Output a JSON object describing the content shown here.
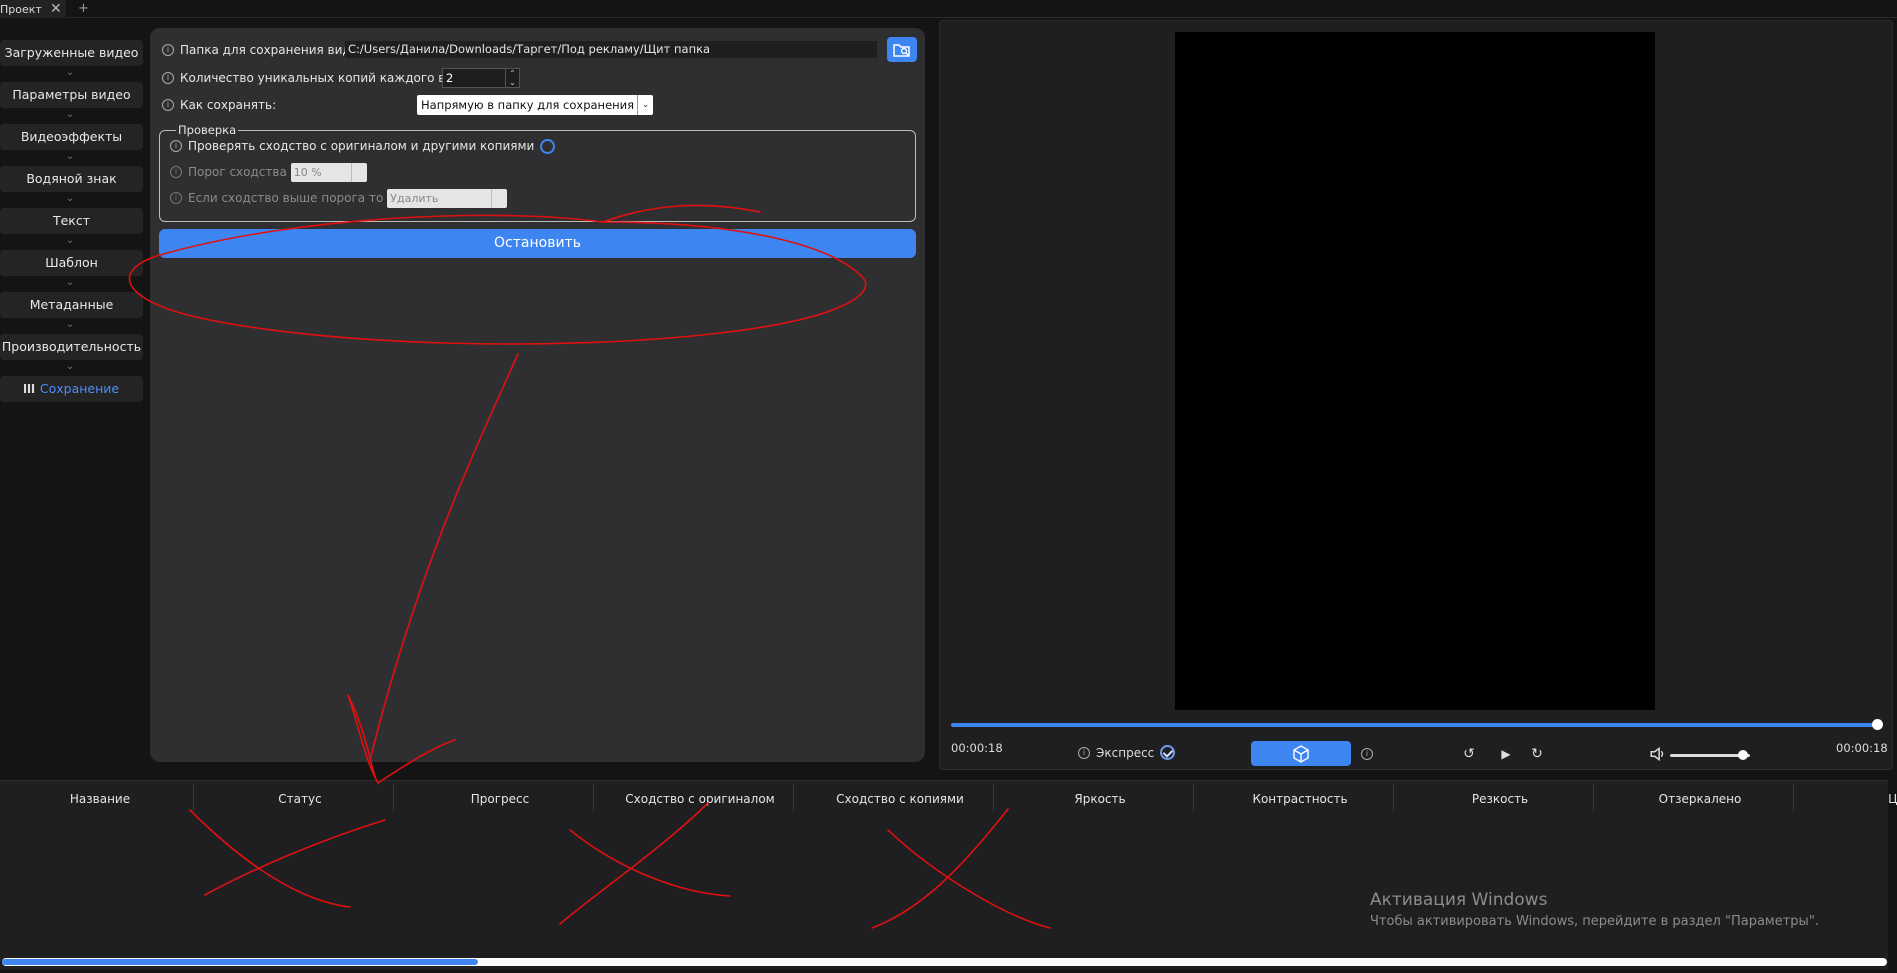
{
  "tabs": {
    "project_label": "Проект",
    "close_glyph": "✕",
    "add_glyph": "+"
  },
  "sidebar": {
    "items": [
      {
        "label": "Загруженные видео"
      },
      {
        "label": "Параметры видео"
      },
      {
        "label": "Видеоэффекты"
      },
      {
        "label": "Водяной знак"
      },
      {
        "label": "Текст"
      },
      {
        "label": "Шаблон"
      },
      {
        "label": "Метаданные"
      },
      {
        "label": "Производительность"
      },
      {
        "label": "Сохранение",
        "active": true
      }
    ]
  },
  "settings": {
    "save_folder_label": "Папка для сохранения видео",
    "save_folder_value": "C:/Users/Данила/Downloads/Таргет/Под рекламу/Щит папка",
    "copies_label": "Количество уникальных копий каждого видео",
    "copies_value": "2",
    "save_mode_label": "Как сохранять:",
    "save_mode_value": "Напрямую в папку для сохранения",
    "check_group_title": "Проверка",
    "check_similarity_label": "Проверять сходство с оригиналом и другими копиями",
    "threshold_label": "Порог сходства",
    "threshold_value": "10 %",
    "if_above_label": "Если сходство выше порога то",
    "if_above_value": "Удалить",
    "stop_button": "Остановить"
  },
  "player": {
    "time_current": "00:00:18",
    "time_total": "00:00:18",
    "express_label": "Экспресс",
    "progress_fraction": 1.0,
    "volume_fraction": 0.9
  },
  "table": {
    "columns": [
      "Название",
      "Статус",
      "Прогресс",
      "Сходство с оригиналом",
      "Сходство с копиями",
      "Яркость",
      "Контрастность",
      "Резкость",
      "Отзеркалено",
      "Цве"
    ]
  },
  "watermark": {
    "title": "Активация Windows",
    "subtitle": "Чтобы активировать Windows, перейдите в раздел \"Параметры\"."
  },
  "colors": {
    "accent": "#3d86f2",
    "annotation": "#e01010"
  }
}
